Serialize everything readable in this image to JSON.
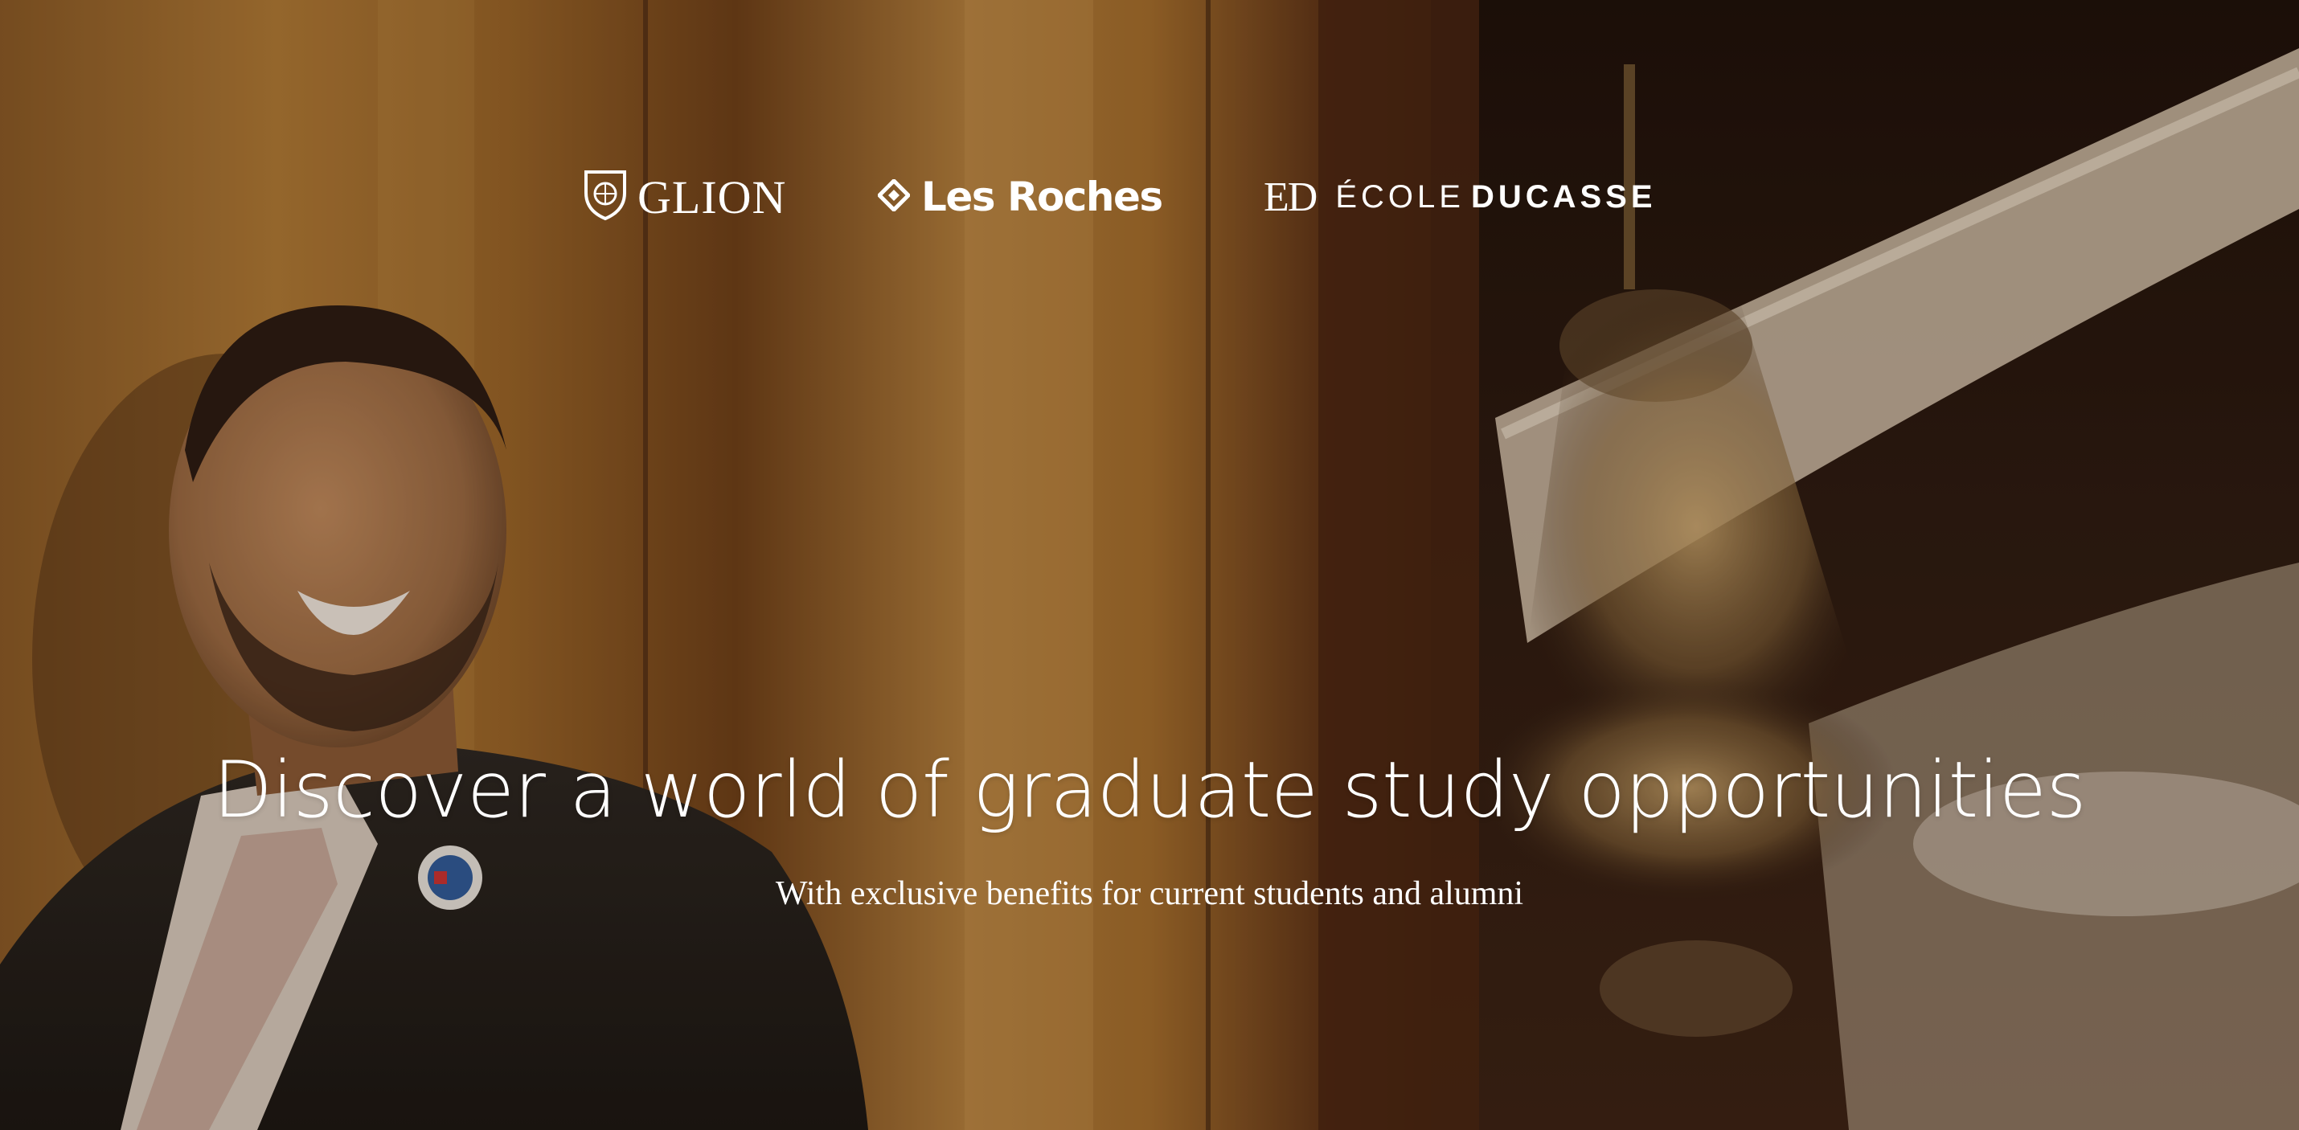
{
  "hero": {
    "logos": {
      "glion": "GLION",
      "les_roches": "Les Roches",
      "ducasse_ecole": "ÉCOLE",
      "ducasse_name": "DUCASSE",
      "ducasse_mark": "ED"
    },
    "headline": "Discover a world of graduate study opportunities",
    "subheadline": "With exclusive benefits for current students and alumni"
  },
  "colors": {
    "text": "#ffffff",
    "wall_gold": "#b07a35",
    "dark_wood": "#3a1e10",
    "ceiling_cream": "#d9c8b0"
  },
  "icons": {
    "glion": "shield-crest-icon",
    "les_roches": "diamond-icon"
  }
}
